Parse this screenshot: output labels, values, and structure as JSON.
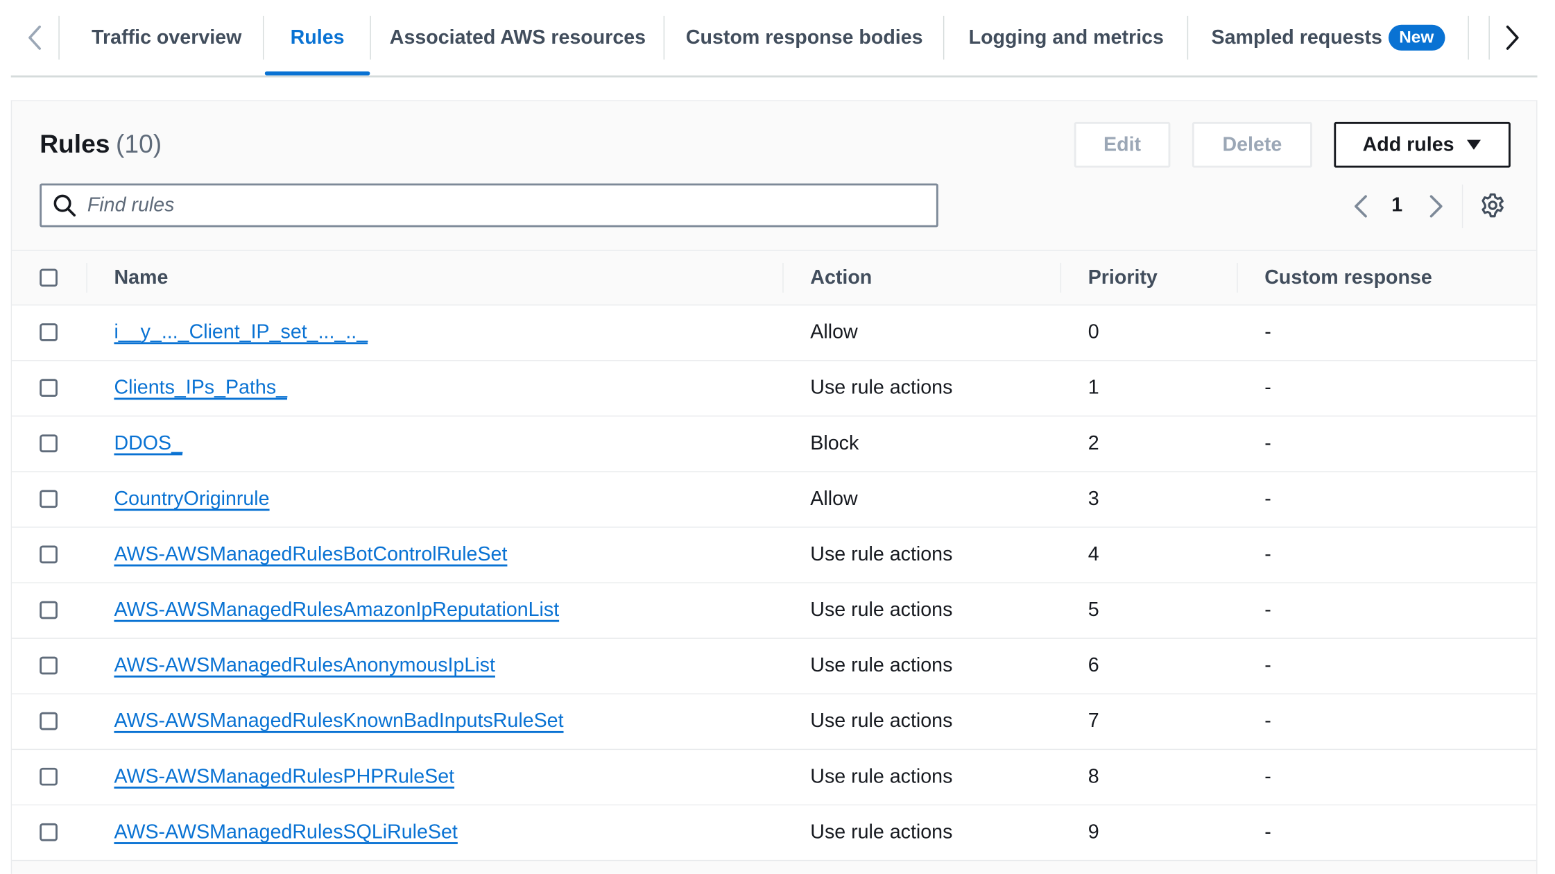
{
  "tabs": {
    "items": [
      {
        "label": "Traffic overview",
        "active": false
      },
      {
        "label": "Rules",
        "active": true
      },
      {
        "label": "Associated AWS resources",
        "active": false
      },
      {
        "label": "Custom response bodies",
        "active": false
      },
      {
        "label": "Logging and metrics",
        "active": false
      },
      {
        "label": "Sampled requests",
        "active": false,
        "badge": "New"
      }
    ]
  },
  "panel": {
    "title": "Rules",
    "count": "(10)",
    "buttons": {
      "edit": "Edit",
      "delete": "Delete",
      "add_rules": "Add rules"
    },
    "search": {
      "placeholder": "Find rules",
      "value": ""
    },
    "pagination": {
      "current_page": "1"
    }
  },
  "table": {
    "columns": {
      "name": "Name",
      "action": "Action",
      "priority": "Priority",
      "custom": "Custom response"
    },
    "rows": [
      {
        "name": "i__y_..._Client_IP_set_..._.._",
        "action": "Allow",
        "priority": "0",
        "custom": "-"
      },
      {
        "name": "Clients_IPs_Paths_",
        "action": "Use rule actions",
        "priority": "1",
        "custom": "-"
      },
      {
        "name": "DDOS_",
        "action": "Block",
        "priority": "2",
        "custom": "-"
      },
      {
        "name": "CountryOriginrule",
        "action": "Allow",
        "priority": "3",
        "custom": "-"
      },
      {
        "name": "AWS-AWSManagedRulesBotControlRuleSet",
        "action": "Use rule actions",
        "priority": "4",
        "custom": "-"
      },
      {
        "name": "AWS-AWSManagedRulesAmazonIpReputationList",
        "action": "Use rule actions",
        "priority": "5",
        "custom": "-"
      },
      {
        "name": "AWS-AWSManagedRulesAnonymousIpList",
        "action": "Use rule actions",
        "priority": "6",
        "custom": "-"
      },
      {
        "name": "AWS-AWSManagedRulesKnownBadInputsRuleSet",
        "action": "Use rule actions",
        "priority": "7",
        "custom": "-"
      },
      {
        "name": "AWS-AWSManagedRulesPHPRuleSet",
        "action": "Use rule actions",
        "priority": "8",
        "custom": "-"
      },
      {
        "name": "AWS-AWSManagedRulesSQLiRuleSet",
        "action": "Use rule actions",
        "priority": "9",
        "custom": "-"
      }
    ]
  },
  "icons": {
    "tab_prev": "chevron-left-icon",
    "tab_next": "chevron-right-icon",
    "search": "search-icon",
    "add_rules_caret": "caret-down-icon",
    "page_prev": "chevron-left-icon",
    "page_next": "chevron-right-icon",
    "preferences": "gear-icon"
  },
  "colors": {
    "accent": "#0972d3",
    "text": "#16191f",
    "muted": "#5f6b7a",
    "border": "#e9ebed",
    "disabled": "#9ba7b6"
  }
}
